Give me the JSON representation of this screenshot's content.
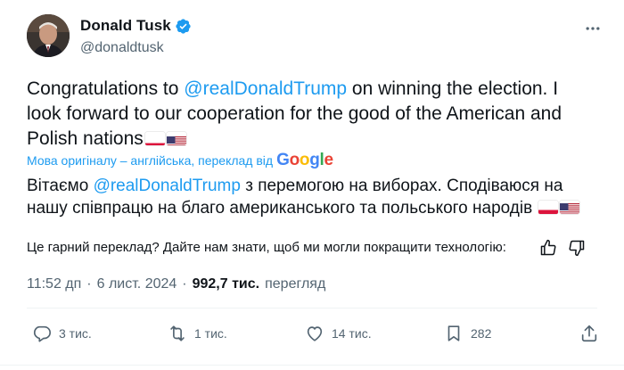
{
  "author": {
    "name": "Donald Tusk",
    "handle": "@donaldtusk",
    "verified": true
  },
  "tweet": {
    "text_prefix": "Congratulations to ",
    "mention": "@realDonaldTrump",
    "text_suffix": " on winning the election. I look forward to our cooperation for the good of the American and Polish nations",
    "flags": [
      "flag-poland",
      "flag-usa"
    ]
  },
  "translation": {
    "note": "Мова оригіналу – англійська, переклад від",
    "provider": "Google",
    "text_prefix": "Вітаємо ",
    "mention": "@realDonaldTrump",
    "text_suffix": " з перемогою на виборах. Сподіваюся на нашу співпрацю на благо американського та польського народів",
    "feedback_question": "Це гарний переклад? Дайте нам знати, щоб ми могли покращити технологію:"
  },
  "meta": {
    "time": "11:52 дп",
    "date": "6 лист. 2024",
    "views_count": "992,7 тис.",
    "views_label": "перегляд"
  },
  "actions": {
    "replies": "3 тис.",
    "reposts": "1 тис.",
    "likes": "14 тис.",
    "bookmarks": "282"
  },
  "colors": {
    "accent": "#1d9bf0",
    "text": "#0f1419",
    "secondary": "#536471",
    "divider": "#eff3f4"
  }
}
